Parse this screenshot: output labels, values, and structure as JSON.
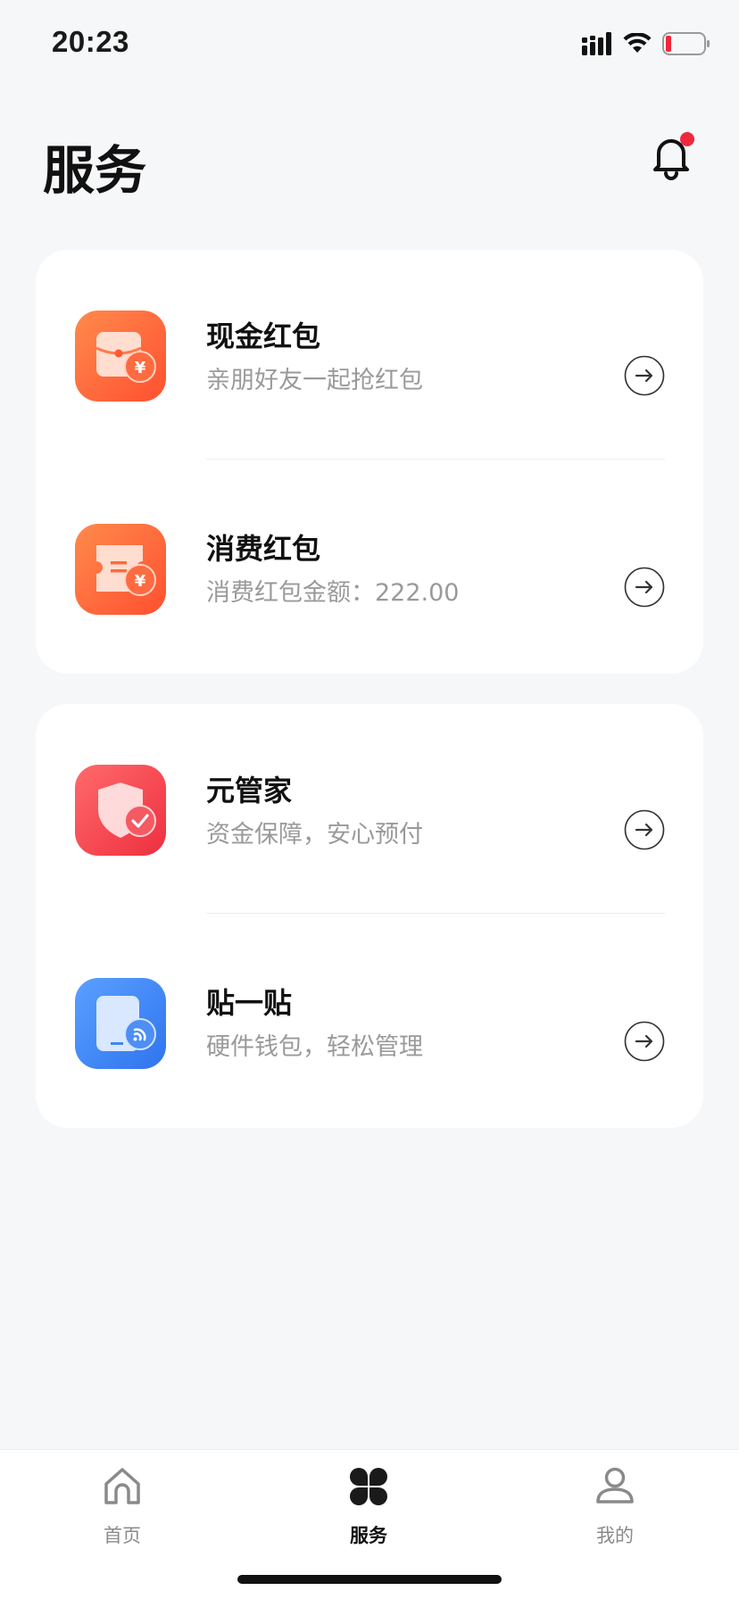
{
  "status_bar": {
    "time": "20:23"
  },
  "header": {
    "title": "服务"
  },
  "colors": {
    "accent_red": "#f0283c",
    "orange_icon": "#ff6a3d",
    "red_icon": "#f4414f",
    "blue_icon": "#3e86f5"
  },
  "cards": [
    {
      "items": [
        {
          "title": "现金红包",
          "subtitle": "亲朋好友一起抢红包",
          "icon": "red-envelope-icon"
        },
        {
          "title": "消费红包",
          "subtitle": "消费红包金额：222.00",
          "icon": "consume-voucher-icon"
        }
      ]
    },
    {
      "items": [
        {
          "title": "元管家",
          "subtitle": "资金保障，安心预付",
          "icon": "shield-check-icon"
        },
        {
          "title": "贴一贴",
          "subtitle": "硬件钱包，轻松管理",
          "icon": "nfc-card-icon"
        }
      ]
    }
  ],
  "tabbar": {
    "tabs": [
      {
        "label": "首页",
        "icon": "home-icon",
        "active": false
      },
      {
        "label": "服务",
        "icon": "grid-icon",
        "active": true
      },
      {
        "label": "我的",
        "icon": "user-icon",
        "active": false
      }
    ]
  }
}
